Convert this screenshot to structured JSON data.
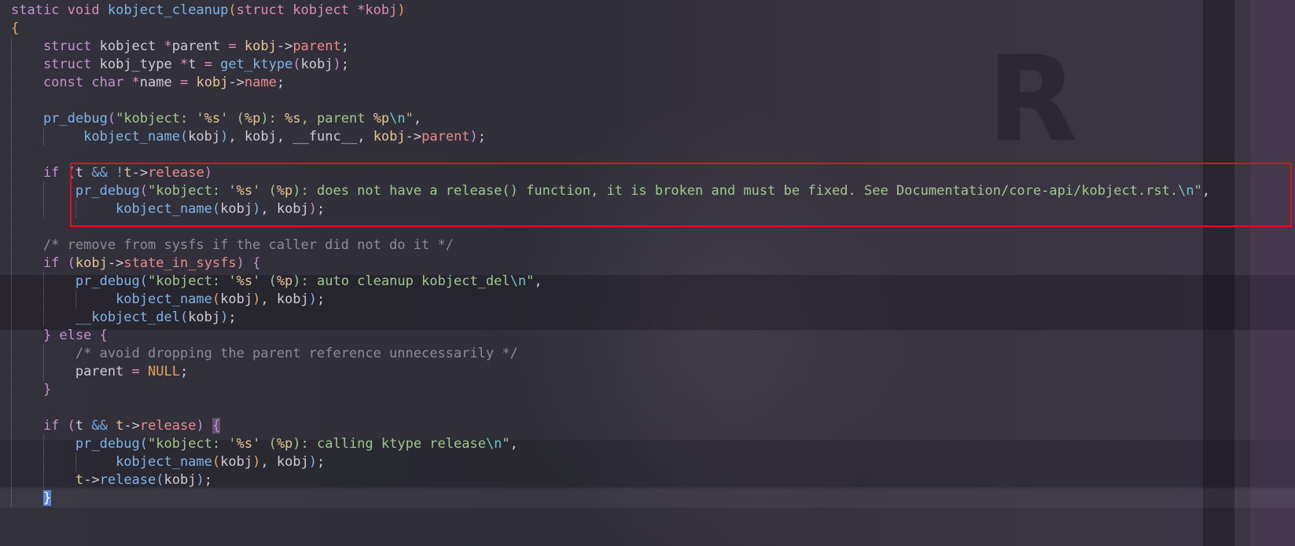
{
  "editor": {
    "language": "c",
    "current_line": 27,
    "colors": {
      "background": "#2e2d38",
      "keyword": "#c38fcf",
      "type": "#d98bb6",
      "function": "#7fb3e8",
      "variable": "#e6c690",
      "field": "#ec8a8a",
      "string": "#9fc98a",
      "escape": "#6fc4c4",
      "comment": "#8c8a96",
      "constant": "#e6a35a",
      "cursor": "#5a86d6",
      "annotation_box": "#e0101b"
    },
    "lines": [
      {
        "indent": 0,
        "guides": [],
        "tokens": [
          [
            "kw",
            "static "
          ],
          [
            "ty",
            "void "
          ],
          [
            "fn",
            "kobject_cleanup"
          ],
          [
            "pr1",
            "("
          ],
          [
            "ty",
            "struct kobject "
          ],
          [
            "op",
            "*"
          ],
          [
            "ty",
            "kobj"
          ],
          [
            "pr1",
            ")"
          ]
        ]
      },
      {
        "indent": 0,
        "guides": [],
        "tokens": [
          [
            "pr1",
            "{"
          ]
        ]
      },
      {
        "indent": 4,
        "guides": [
          0
        ],
        "tokens": [
          [
            "kw",
            "struct "
          ],
          [
            "plain",
            "kobject "
          ],
          [
            "op",
            "*"
          ],
          [
            "plain",
            "parent "
          ],
          [
            "op",
            "= "
          ],
          [
            "var",
            "kobj"
          ],
          [
            "pn",
            "->"
          ],
          [
            "fld",
            "parent"
          ],
          [
            "pn",
            ";"
          ]
        ]
      },
      {
        "indent": 4,
        "guides": [
          0
        ],
        "tokens": [
          [
            "kw",
            "struct "
          ],
          [
            "plain",
            "kobj_type "
          ],
          [
            "op",
            "*"
          ],
          [
            "plain",
            "t "
          ],
          [
            "op",
            "= "
          ],
          [
            "fn",
            "get_ktype"
          ],
          [
            "pr2",
            "("
          ],
          [
            "plain",
            "kobj"
          ],
          [
            "pr2",
            ")"
          ],
          [
            "pn",
            ";"
          ]
        ]
      },
      {
        "indent": 4,
        "guides": [
          0
        ],
        "tokens": [
          [
            "kw",
            "const "
          ],
          [
            "kw",
            "char "
          ],
          [
            "op",
            "*"
          ],
          [
            "plain",
            "name "
          ],
          [
            "op",
            "= "
          ],
          [
            "var",
            "kobj"
          ],
          [
            "pn",
            "->"
          ],
          [
            "fld",
            "name"
          ],
          [
            "pn",
            ";"
          ]
        ]
      },
      {
        "indent": 0,
        "guides": [
          0
        ],
        "tokens": []
      },
      {
        "indent": 4,
        "guides": [
          0
        ],
        "tokens": [
          [
            "fn",
            "pr_debug"
          ],
          [
            "pr2",
            "("
          ],
          [
            "str",
            "\"kobject: '"
          ],
          [
            "fmt",
            "%s"
          ],
          [
            "str",
            "' ("
          ],
          [
            "fmt",
            "%p"
          ],
          [
            "str",
            "): "
          ],
          [
            "fmt",
            "%s"
          ],
          [
            "str",
            ", parent "
          ],
          [
            "fmt",
            "%p"
          ],
          [
            "esc",
            "\\n"
          ],
          [
            "str",
            "\""
          ],
          [
            "pn",
            ","
          ]
        ]
      },
      {
        "indent": 9,
        "guides": [
          0,
          4
        ],
        "tokens": [
          [
            "fn",
            "kobject_name"
          ],
          [
            "pr3",
            "("
          ],
          [
            "plain",
            "kobj"
          ],
          [
            "pr3",
            ")"
          ],
          [
            "pn",
            ", "
          ],
          [
            "plain",
            "kobj"
          ],
          [
            "pn",
            ", "
          ],
          [
            "plain",
            "__func__"
          ],
          [
            "pn",
            ", "
          ],
          [
            "var",
            "kobj"
          ],
          [
            "pn",
            "->"
          ],
          [
            "fld",
            "parent"
          ],
          [
            "pr2",
            ")"
          ],
          [
            "pn",
            ";"
          ]
        ]
      },
      {
        "indent": 0,
        "guides": [
          0
        ],
        "tokens": []
      },
      {
        "indent": 4,
        "guides": [
          0
        ],
        "tokens": [
          [
            "kw",
            "if "
          ],
          [
            "pr2",
            "("
          ],
          [
            "plain",
            "t "
          ],
          [
            "opb",
            "&& "
          ],
          [
            "opb",
            "!"
          ],
          [
            "var",
            "t"
          ],
          [
            "pn",
            "->"
          ],
          [
            "fld",
            "release"
          ],
          [
            "pr2",
            ")"
          ]
        ]
      },
      {
        "indent": 8,
        "guides": [
          0,
          4
        ],
        "tokens": [
          [
            "fn",
            "pr_debug"
          ],
          [
            "pr2",
            "("
          ],
          [
            "str",
            "\"kobject: '"
          ],
          [
            "fmt",
            "%s"
          ],
          [
            "str",
            "' ("
          ],
          [
            "fmt",
            "%p"
          ],
          [
            "str",
            "): does not have a release() function, it is broken and must be fixed. See Documentation/core-api/kobject.rst."
          ],
          [
            "esc",
            "\\n"
          ],
          [
            "str",
            "\""
          ],
          [
            "pn",
            ","
          ]
        ]
      },
      {
        "indent": 13,
        "guides": [
          0,
          4,
          8
        ],
        "tokens": [
          [
            "fn",
            "kobject_name"
          ],
          [
            "pr3",
            "("
          ],
          [
            "plain",
            "kobj"
          ],
          [
            "pr3",
            ")"
          ],
          [
            "pn",
            ", "
          ],
          [
            "plain",
            "kobj"
          ],
          [
            "pr2",
            ")"
          ],
          [
            "pn",
            ";"
          ]
        ]
      },
      {
        "indent": 0,
        "guides": [
          0
        ],
        "tokens": []
      },
      {
        "indent": 4,
        "guides": [
          0
        ],
        "tokens": [
          [
            "cm",
            "/* remove from sysfs if the caller did not do it */"
          ]
        ]
      },
      {
        "indent": 4,
        "guides": [
          0
        ],
        "tokens": [
          [
            "kw",
            "if "
          ],
          [
            "pr2",
            "("
          ],
          [
            "var",
            "kobj"
          ],
          [
            "pn",
            "->"
          ],
          [
            "fld",
            "state_in_sysfs"
          ],
          [
            "pr2",
            ") "
          ],
          [
            "br2",
            "{"
          ]
        ]
      },
      {
        "indent": 8,
        "guides": [
          0,
          4
        ],
        "tokens": [
          [
            "fn",
            "pr_debug"
          ],
          [
            "pr3",
            "("
          ],
          [
            "str",
            "\"kobject: '"
          ],
          [
            "fmt",
            "%s"
          ],
          [
            "str",
            "' ("
          ],
          [
            "fmt",
            "%p"
          ],
          [
            "str",
            "): auto cleanup kobject_del"
          ],
          [
            "esc",
            "\\n"
          ],
          [
            "str",
            "\""
          ],
          [
            "pn",
            ","
          ]
        ]
      },
      {
        "indent": 13,
        "guides": [
          0,
          4,
          8
        ],
        "tokens": [
          [
            "fn",
            "kobject_name"
          ],
          [
            "pr1",
            "("
          ],
          [
            "plain",
            "kobj"
          ],
          [
            "pr1",
            ")"
          ],
          [
            "pn",
            ", "
          ],
          [
            "plain",
            "kobj"
          ],
          [
            "pr3",
            ")"
          ],
          [
            "pn",
            ";"
          ]
        ]
      },
      {
        "indent": 8,
        "guides": [
          0,
          4
        ],
        "tokens": [
          [
            "fn",
            "__kobject_del"
          ],
          [
            "pr3",
            "("
          ],
          [
            "plain",
            "kobj"
          ],
          [
            "pr3",
            ")"
          ],
          [
            "pn",
            ";"
          ]
        ]
      },
      {
        "indent": 4,
        "guides": [
          0
        ],
        "tokens": [
          [
            "br2",
            "} "
          ],
          [
            "kw",
            "else "
          ],
          [
            "br2",
            "{"
          ]
        ]
      },
      {
        "indent": 8,
        "guides": [
          0,
          4
        ],
        "tokens": [
          [
            "cm",
            "/* avoid dropping the parent reference unnecessarily */"
          ]
        ]
      },
      {
        "indent": 8,
        "guides": [
          0,
          4
        ],
        "tokens": [
          [
            "plain",
            "parent "
          ],
          [
            "op",
            "= "
          ],
          [
            "cst",
            "NULL"
          ],
          [
            "pn",
            ";"
          ]
        ]
      },
      {
        "indent": 4,
        "guides": [
          0
        ],
        "tokens": [
          [
            "br2",
            "}"
          ]
        ]
      },
      {
        "indent": 0,
        "guides": [
          0
        ],
        "tokens": []
      },
      {
        "indent": 4,
        "guides": [
          0
        ],
        "tokens": [
          [
            "kw",
            "if "
          ],
          [
            "pr2",
            "("
          ],
          [
            "plain",
            "t "
          ],
          [
            "opb",
            "&& "
          ],
          [
            "var",
            "t"
          ],
          [
            "pn",
            "->"
          ],
          [
            "fld",
            "release"
          ],
          [
            "pr2",
            ") "
          ],
          [
            "brh",
            "{"
          ]
        ]
      },
      {
        "indent": 8,
        "guides": [
          0,
          4
        ],
        "tokens": [
          [
            "fn",
            "pr_debug"
          ],
          [
            "pr3",
            "("
          ],
          [
            "str",
            "\"kobject: '"
          ],
          [
            "fmt",
            "%s"
          ],
          [
            "str",
            "' ("
          ],
          [
            "fmt",
            "%p"
          ],
          [
            "str",
            "): calling ktype release"
          ],
          [
            "esc",
            "\\n"
          ],
          [
            "str",
            "\""
          ],
          [
            "pn",
            ","
          ]
        ]
      },
      {
        "indent": 13,
        "guides": [
          0,
          4,
          8
        ],
        "tokens": [
          [
            "fn",
            "kobject_name"
          ],
          [
            "pr1",
            "("
          ],
          [
            "plain",
            "kobj"
          ],
          [
            "pr1",
            ")"
          ],
          [
            "pn",
            ", "
          ],
          [
            "plain",
            "kobj"
          ],
          [
            "pr3",
            ")"
          ],
          [
            "pn",
            ";"
          ]
        ]
      },
      {
        "indent": 8,
        "guides": [
          0,
          4
        ],
        "tokens": [
          [
            "var",
            "t"
          ],
          [
            "pn",
            "->"
          ],
          [
            "fn",
            "release"
          ],
          [
            "pr3",
            "("
          ],
          [
            "plain",
            "kobj"
          ],
          [
            "pr3",
            ")"
          ],
          [
            "pn",
            ";"
          ]
        ]
      },
      {
        "indent": 4,
        "guides": [
          0
        ],
        "tokens": [
          [
            "brc",
            "}"
          ]
        ]
      }
    ]
  }
}
